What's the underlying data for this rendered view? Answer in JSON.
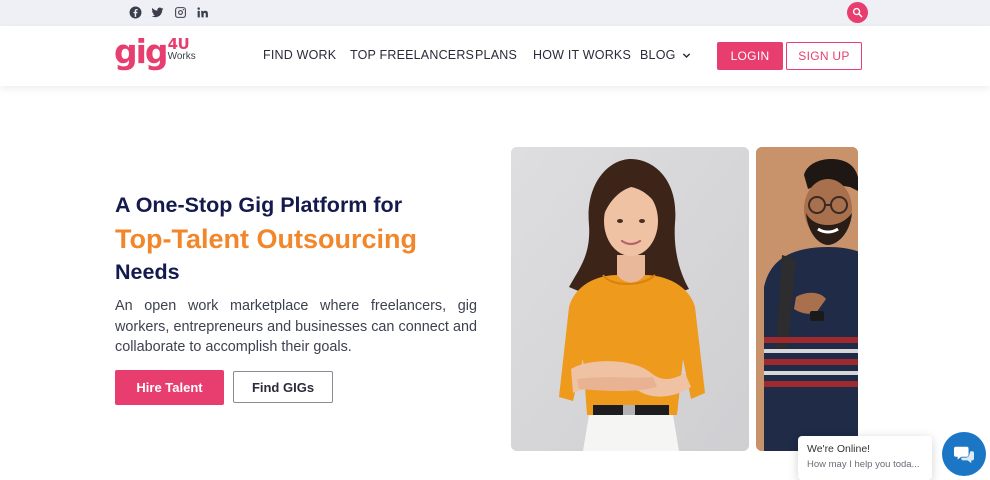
{
  "topbar": {
    "social_icons": [
      "facebook-icon",
      "twitter-icon",
      "instagram-icon",
      "linkedin-icon"
    ],
    "search_icon": "search-icon"
  },
  "logo": {
    "main": "gig",
    "sup": "4U",
    "sub": "Works"
  },
  "nav": {
    "items": [
      {
        "label": "FIND WORK"
      },
      {
        "label": "TOP FREELANCERS"
      },
      {
        "label": "PLANS"
      },
      {
        "label": "HOW IT WORKS"
      },
      {
        "label": "BLOG",
        "icon": "chevron-down-icon"
      }
    ],
    "login": "LOGIN",
    "signup": "SIGN UP"
  },
  "hero": {
    "line1": "A One-Stop Gig Platform for",
    "line2": "Top-Talent Outsourcing",
    "line3": "Needs",
    "description": "An open work marketplace where freelancers, gig workers, entrepreneurs and businesses can connect and collaborate to accomplish their goals.",
    "hire_button": "Hire Talent",
    "gigs_button": "Find GIGs"
  },
  "chat": {
    "title": "We're Online!",
    "subtitle": "How may I help you toda..."
  },
  "colors": {
    "brand": "#e83d6f",
    "accent_orange": "#f2862a",
    "heading_navy": "#151a4d",
    "chat_blue": "#1b76c5"
  }
}
